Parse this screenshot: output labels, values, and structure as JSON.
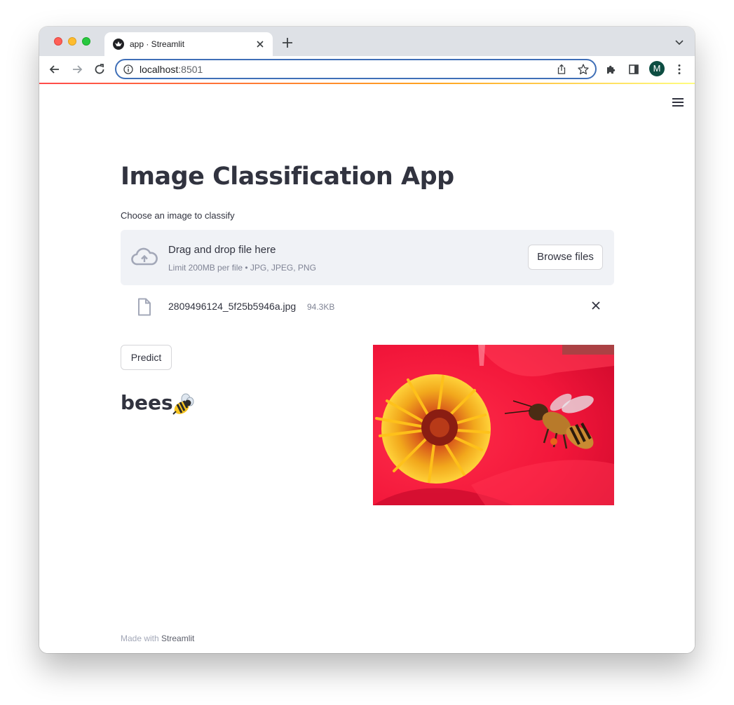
{
  "browser": {
    "tab_title": "app · Streamlit",
    "url_host": "localhost",
    "url_port": ":8501",
    "avatar_letter": "M"
  },
  "page": {
    "title": "Image Classification App",
    "uploader_label": "Choose an image to classify",
    "dropzone_text": "Drag and drop file here",
    "dropzone_limit": "Limit 200MB per file • JPG, JPEG, PNG",
    "browse_label": "Browse files",
    "file_name": "2809496124_5f25b5946a.jpg",
    "file_size": "94.3KB",
    "predict_label": "Predict",
    "prediction": "bees",
    "footer_prefix": "Made with ",
    "footer_brand": "Streamlit"
  },
  "colors": {
    "accent": "#ff4b4b",
    "text": "#31333f",
    "dropzone_bg": "#f0f2f6",
    "omnibox_focus": "#3f6fb7"
  }
}
